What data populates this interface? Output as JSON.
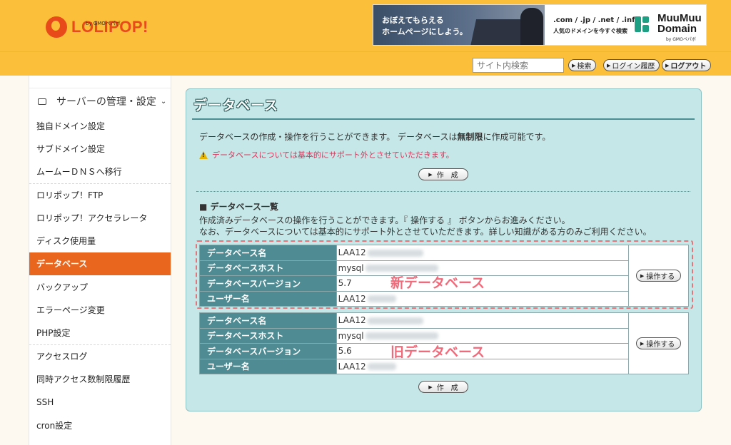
{
  "header": {
    "logo_text": "LOLIPOP!",
    "logo_sub": "by GMOペパボ",
    "banner": {
      "left_text_line1": "おぼえてもらえる",
      "left_text_line2": "ホームページにしよう。",
      "domains": ".com / .jp / .net / .info",
      "tagline": "人気のドメインを今すぐ検索",
      "brand_line1": "MuuMuu",
      "brand_line2": "Domain",
      "brand_sub": "by GMOペパボ"
    }
  },
  "subbar": {
    "search_placeholder": "サイト内検索",
    "search_button": "検索",
    "login_history": "ログイン履歴",
    "logout": "ログアウト"
  },
  "sidebar": {
    "category": "サーバーの管理・設定",
    "items": [
      "独自ドメイン設定",
      "サブドメイン設定",
      "ムームーＤＮＳへ移行",
      "ロリポップ！FTP",
      "ロリポップ！アクセラレータ",
      "ディスク使用量",
      "データベース",
      "バックアップ",
      "エラーページ変更",
      "PHP設定",
      "アクセスログ",
      "同時アクセス数制限履歴",
      "SSH",
      "cron設定"
    ]
  },
  "main": {
    "title": "データベース",
    "intro_before": "データベースの作成・操作を行うことができます。 データベースは",
    "intro_bold": "無制限",
    "intro_after": "に作成可能です。",
    "warning": "データベースについては基本的にサポート外とさせていただきます。",
    "create_button": "作　成",
    "list_heading": "■ データベース一覧",
    "list_desc_line1": "作成済みデータベースの操作を行うことができます。『 操作する 』 ボタンからお進みください。",
    "list_desc_line2": "なお、データベースについては基本的にサポート外とさせていただきます。詳しい知識がある方のみご利用ください。",
    "labels": {
      "db_name": "データベース名",
      "db_host": "データベースホスト",
      "db_version": "データベースバージョン",
      "user_name": "ユーザー名"
    },
    "operate_button": "操作する",
    "databases": [
      {
        "name": "LAA12",
        "host": "mysql",
        "version": "5.7",
        "user": "LAA12",
        "annotation": "新データベース"
      },
      {
        "name": "LAA12",
        "host": "mysql",
        "version": "5.6",
        "user": "LAA12",
        "annotation": "旧データベース"
      }
    ]
  },
  "colors": {
    "header_bg": "#fbbf3a",
    "accent_orange": "#e8661e",
    "panel_bg": "#c5e7e7",
    "label_bg": "#4e8b93",
    "annotation": "#f26a7a"
  }
}
